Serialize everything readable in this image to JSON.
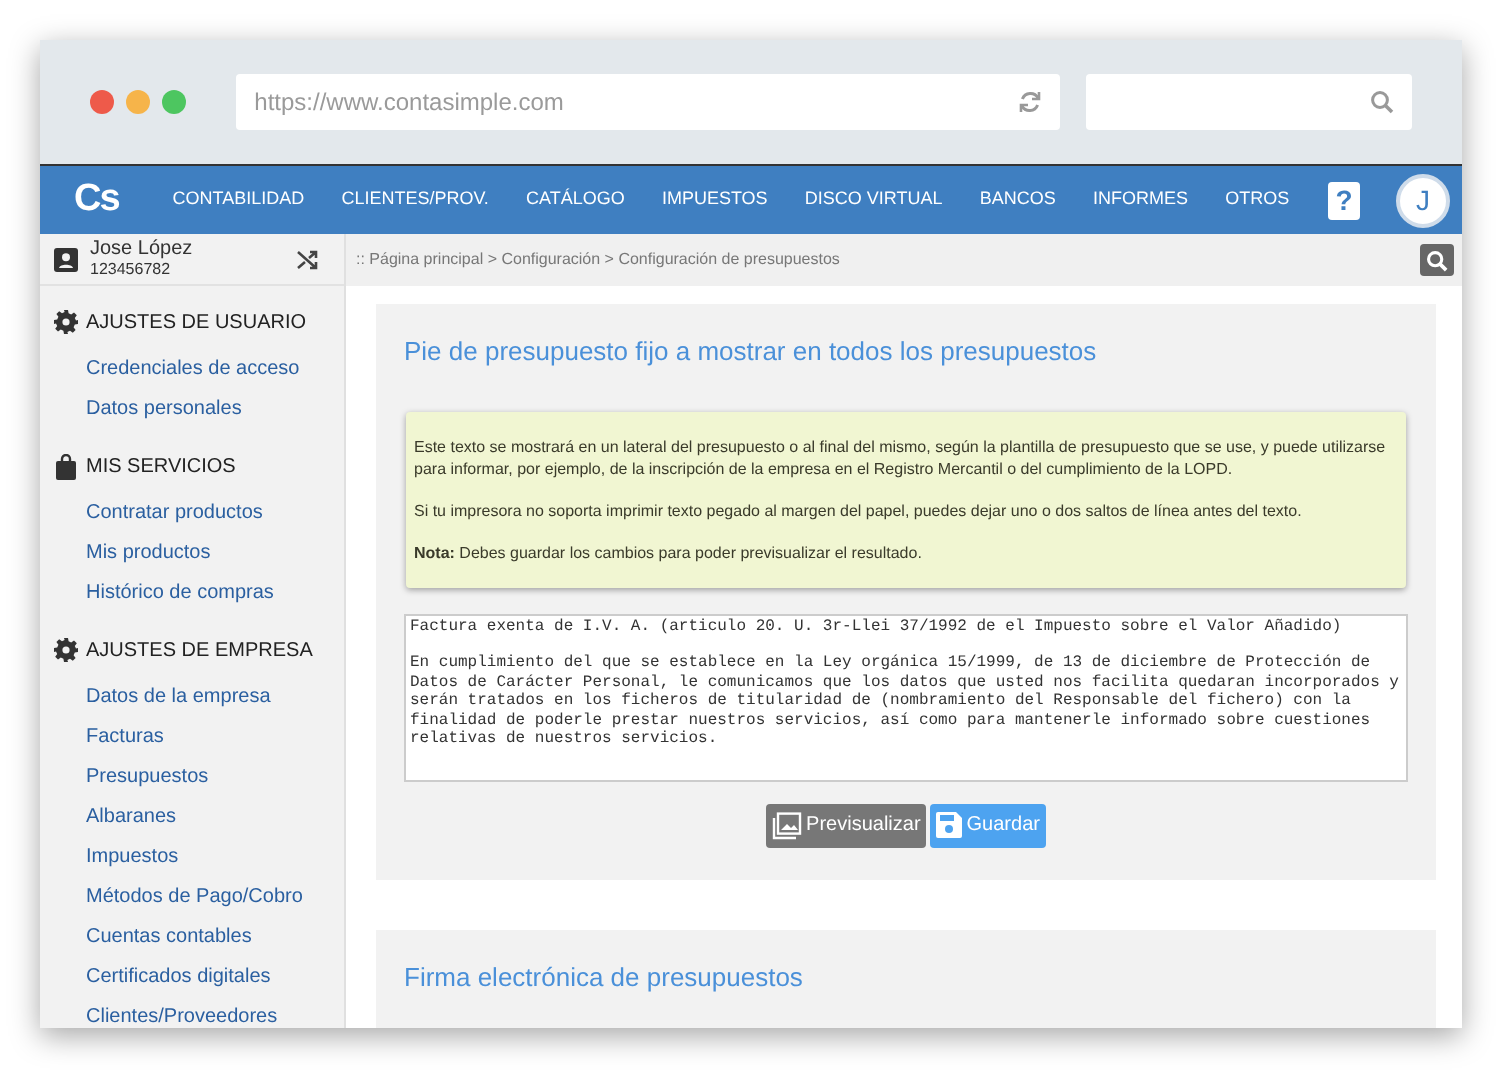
{
  "browser": {
    "url": "https://www.contasimple.com"
  },
  "nav": {
    "logo": "Cs",
    "items": [
      "CONTABILIDAD",
      "CLIENTES/PROV.",
      "CATÁLOGO",
      "IMPUESTOS",
      "DISCO VIRTUAL",
      "BANCOS",
      "INFORMES",
      "OTROS"
    ],
    "help": "?",
    "avatar": "J"
  },
  "user": {
    "name": "Jose López",
    "number": "123456782"
  },
  "breadcrumb": ":: Página principal > Configuración > Configuración de presupuestos",
  "sidebar": [
    {
      "title": "AJUSTES DE USUARIO",
      "kind": "gear",
      "items": [
        "Credenciales de acceso",
        "Datos personales"
      ]
    },
    {
      "title": "MIS SERVICIOS",
      "kind": "bag",
      "items": [
        "Contratar productos",
        "Mis productos",
        "Histórico de compras"
      ]
    },
    {
      "title": "AJUSTES DE EMPRESA",
      "kind": "gear",
      "items": [
        "Datos de la empresa",
        "Facturas",
        "Presupuestos",
        "Albaranes",
        "Impuestos",
        "Métodos de Pago/Cobro",
        "Cuentas contables",
        "Certificados digitales",
        "Clientes/Proveedores"
      ]
    }
  ],
  "panels": [
    {
      "title": "Pie de presupuesto fijo a mostrar en todos los presupuestos",
      "info": [
        "Este texto se mostrará en un lateral del presupuesto o al final del mismo, según la plantilla de presupuesto que se use, y puede utilizarse para informar, por ejemplo, de la inscripción de la empresa en el Registro Mercantil o del cumplimiento de la LOPD.",
        "Si tu impresora no soporta imprimir texto pegado al margen del papel, puedes dejar uno o dos saltos de línea antes del texto.",
        "**Nota:** Debes guardar los cambios para poder previsualizar el resultado."
      ],
      "text": "Factura exenta de I.V. A. (articulo 20. U. 3r-Llei 37/1992 de el Impuesto sobre el Valor Añadido)\n\nEn cumplimiento del que se establece en la Ley orgánica 15/1999, de 13 de diciembre de Protección de Datos de Carácter Personal, le comunicamos que los datos que usted nos facilita quedaran incorporados y serán tratados en los ficheros de titularidad de (nombramiento del Responsable del fichero) con la finalidad de poderle prestar nuestros servicios, así como para mantenerle informado sobre cuestiones relativas de nuestros servicios.",
      "buttons": [
        {
          "label": "Previsualizar",
          "kind": "preview"
        },
        {
          "label": "Guardar",
          "kind": "save"
        }
      ]
    },
    {
      "title": "Firma electrónica de presupuestos"
    }
  ]
}
